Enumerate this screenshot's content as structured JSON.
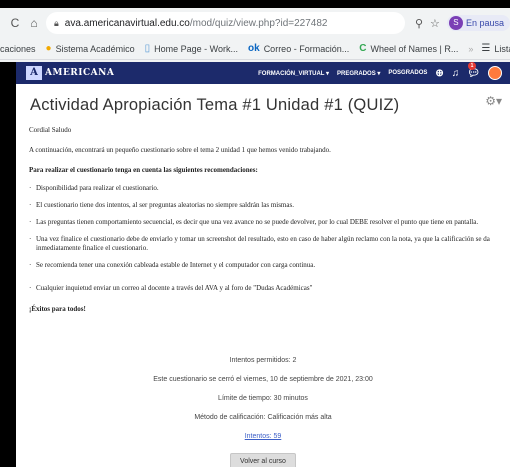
{
  "browser": {
    "url_host": "ava.americanavirtual.edu.co",
    "url_path": "/mod/quiz/view.php?id=227482",
    "profile_label": "En pausa",
    "profile_initial": "S",
    "bookmarks": [
      {
        "icon": "",
        "label": "caciones"
      },
      {
        "icon": "●",
        "label": "Sistema Académico"
      },
      {
        "icon": "▯",
        "label": "Home Page - Work..."
      },
      {
        "icon": "ok",
        "label": "Correo - Formación..."
      },
      {
        "icon": "C",
        "label": "Wheel of Names | R..."
      }
    ],
    "bookmarks_more": "»",
    "reading_list": "Lista de lec"
  },
  "navbar": {
    "logo_mark": "A",
    "logo_text": "AMERICANA",
    "links": [
      "FORMACIÓN_VIRTUAL ▾",
      "PREGRADOS ▾",
      "POSGRADOS"
    ],
    "badge_count": "1",
    "colors": {
      "bar": "#1c2a6b",
      "badge": "#e53935"
    }
  },
  "page": {
    "title": "Actividad Apropiación Tema #1 Unidad #1 (QUIZ)",
    "greeting": "Cordial Saludo",
    "intro": "A continuación, encontrará un pequeño cuestionario sobre el tema 2 unidad 1 que hemos venido trabajando.",
    "recommendations_heading": "Para realizar el cuestionario tenga en cuenta las siguientes recomendaciones:",
    "items": [
      "Disponibilidad para realizar el cuestionario.",
      "El cuestionario  tiene dos intentos, al ser preguntas aleatorias no siempre saldrán las mismas.",
      "Las preguntas tienen comportamiento secuencial, es decir que una vez avance no se puede devolver, por lo cual DEBE  resolver el punto que tiene en pantalla.",
      "Una vez finalice el cuestionario debe de enviarlo y tomar un screenshot del resultado, esto en caso de haber algún reclamo con la nota, ya que la calificación se da inmediatamente finalice el cuestionario.",
      "Se recomienda tener una conexión cableada estable de Internet y el computador con carga continua.",
      "Cualquier inquietud enviar un correo al docente a través del AVA y al foro de \"Dudas Académicas\""
    ],
    "closing": "¡Éxitos para todos!",
    "attempts_allowed": "Intentos permitidos: 2",
    "closed_on": "Este cuestionario se cerró el viernes, 10 de septiembre de 2021, 23:00",
    "time_limit": "Límite de tiempo: 30 minutos",
    "grading_method": "Método de calificación: Calificación más alta",
    "attempts_link": "Intentos: 59",
    "back_button": "Volver al curso"
  }
}
